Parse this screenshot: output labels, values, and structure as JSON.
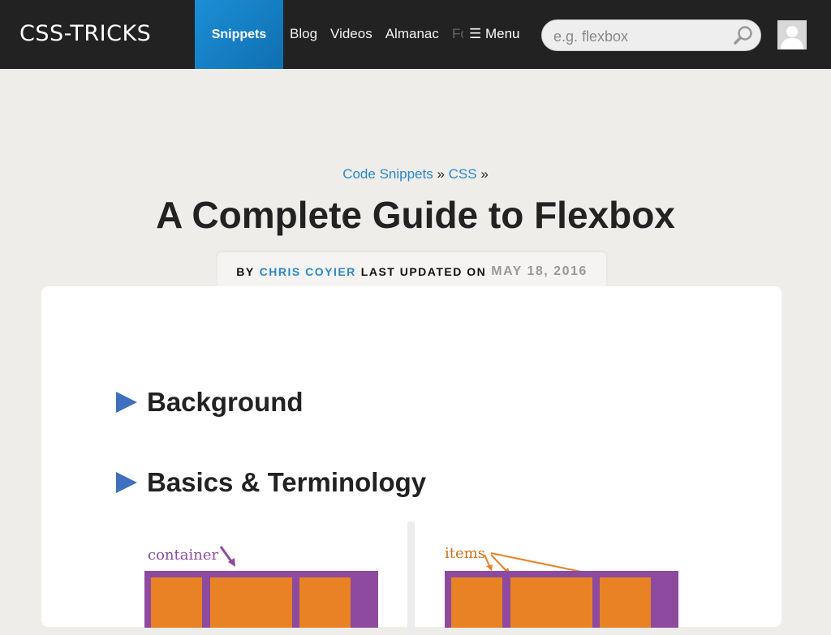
{
  "logo": "CSS-TRICKS",
  "nav": {
    "active": "Snippets",
    "links": [
      "Blog",
      "Videos",
      "Almanac"
    ],
    "faded": "Forums",
    "menu": "☰ Menu"
  },
  "search": {
    "placeholder": "e.g. flexbox"
  },
  "breadcrumb": {
    "item1": "Code Snippets",
    "sep1": " » ",
    "item2": "CSS",
    "sep2": " »"
  },
  "title": "A Complete Guide to Flexbox",
  "byline": {
    "by": "BY",
    "author": "CHRIS COYIER",
    "updated": "LAST UPDATED ON",
    "date": "MAY 18, 2016"
  },
  "sections": [
    "Background",
    "Basics & Terminology"
  ],
  "diagram": {
    "container_label": "container",
    "items_label": "items"
  },
  "colors": {
    "accent": "#2a88c8",
    "container": "#8d4a9e",
    "item": "#e88224",
    "triangle": "#3f6fbf"
  }
}
